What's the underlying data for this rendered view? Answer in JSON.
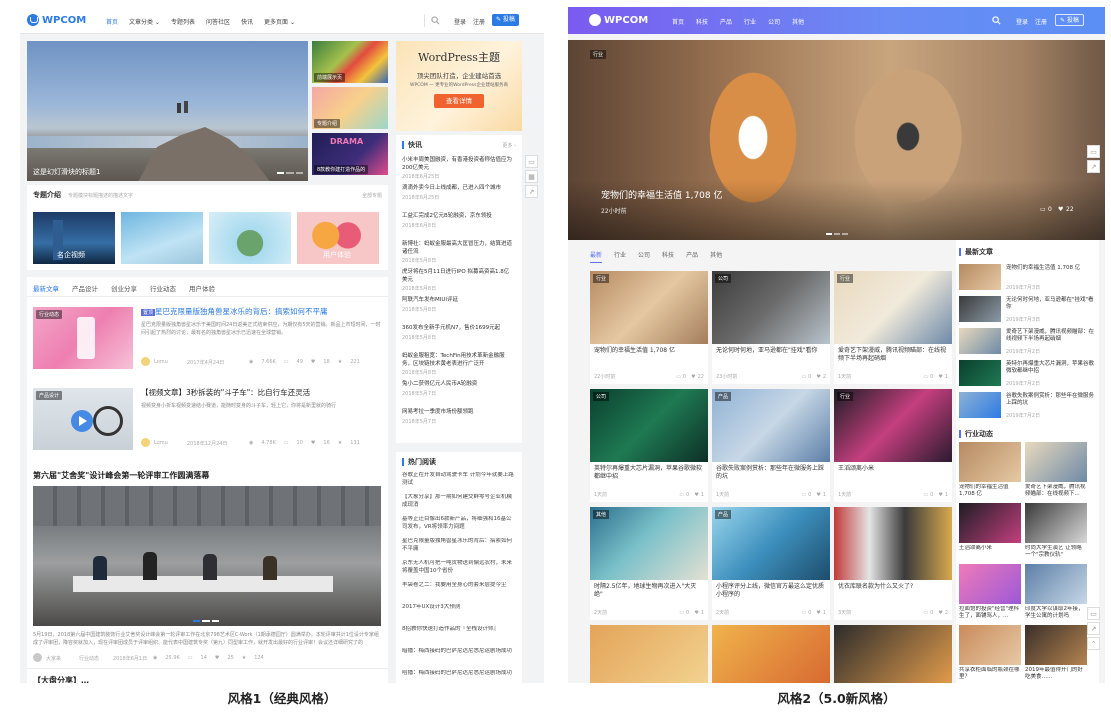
{
  "style1": {
    "nav": {
      "logo": "WPCOM",
      "links": [
        "首页",
        "文章分类 ⌄",
        "专题列表",
        "问答社区",
        "快讯",
        "更多页面 ⌄"
      ],
      "login": "登录",
      "register": "注册",
      "post": "✎ 投稿"
    },
    "hero": {
      "caption": "这是幻灯滑块的标题1"
    },
    "thumbs": [
      "前端展示页",
      "专题介绍",
      "8款教你建打造作品的"
    ],
    "ad": {
      "title": "WordPress主题",
      "sub": "顶尖团队打造，企业建站首选",
      "desc": "WPCOM — 更专业的WordPress企业建站服务商",
      "button": "查看详情"
    },
    "topics": {
      "title": "专题介绍",
      "sub": "专题模块标题描述的描述文字",
      "more": "全部专题",
      "items": [
        "名企视频",
        "",
        "",
        "用户体验"
      ]
    },
    "tabs": [
      "最新文章",
      "产品设计",
      "创业分享",
      "行业动态",
      "用户体验"
    ],
    "posts": [
      {
        "label": "行业动态",
        "badge": "置顶",
        "title": "星巴克限量版独角兽星冰乐的背后：搞索如何不平庸",
        "excerpt": "星巴克限量版独角兽星冰乐于美国时间24日返美正式结束供应，为期仅有5天的营销。新品上市短时间，一时间引起了热烈的讨论，最有名的独角兽星冰乐已迅速在全球营销。",
        "author": "Lomu",
        "date": "2017年4月24日",
        "views": "7.66K",
        "comments": "49",
        "likes": "18",
        "shares": "221"
      },
      {
        "label": "产品设计",
        "title": "【视频文章】3秒拆装的\"斗子车\"：比自行车还灵活",
        "excerpt": "视频变身小折车视频变速结小赛道，能随时变身的斗子车，轻上它，你将是新里就的骑行",
        "author": "Lomu",
        "date": "2018年12月24日",
        "views": "4.78K",
        "comments": "10",
        "likes": "16",
        "shares": "131"
      }
    ],
    "feature": {
      "title": "第六届\"艾舍奖\"设计峰会第一轮评审工作圆满落幕",
      "excerpt": "5月19日，2018第六届中国建筑装饰行业艾舍奖设计峰会第一轮评审工作在北京798艺术区C-Work（1期承德园厅）圆满举办。本轮评审共计1位设计专家组成了评审团，降容奖就加入，现在评审团成员于评审组织、能代表中国建筑专奖（第九）同型审工作，就开发出最好的行业评审！会议还详细研究了的",
      "author": "大家来",
      "cat": "行业动态",
      "date": "2018年6月1日",
      "views": "25.9K",
      "comments": "14",
      "likes": "25",
      "shares": "124"
    },
    "next_title": "【大盘分享】…",
    "flash": {
      "title": "快讯",
      "more": "更多 ›",
      "items": [
        {
          "t": "小米丰周美国融资，有香港投资者称估值应为200亿美元",
          "d": "2018年6月25日"
        },
        {
          "t": "滴滴外卖今日上线成都，已进入四个城市",
          "d": "2018年6月25日"
        },
        {
          "t": "工益汇完成2亿元B轮融资，京东领投",
          "d": "2018年6月8日"
        },
        {
          "t": "新博社：蚂蚁金服最高大匡冒压力，结算进道诸任流",
          "d": "2018年5月8日"
        },
        {
          "t": "虎牙将在5月11日进行IPO 拟募高资高1.8亿美元",
          "d": "2018年5月8日"
        },
        {
          "t": "阿联汽车发布MIUI评延",
          "d": "2018年5月8日"
        },
        {
          "t": "360发布全新手元机N7，售价1699元起",
          "d": "2018年5月8日"
        },
        {
          "t": "蚂蚁金服租宽：TechFin用技术革新金融服务，区块链技术黄老表进行广泛开",
          "d": "2018年5月8日"
        },
        {
          "t": "兔小二获得亿元人民币A轮融资",
          "d": "2018年5月7日"
        },
        {
          "t": "网易考拉一季度市场份额领跑",
          "d": "2018年5月7日"
        }
      ]
    },
    "hot": {
      "title": "热门阅读",
      "items": [
        "谷歌正在开发自动驾驶卡车 计划今年就要上路测试",
        "【大象分享】那一期如何建交群零号企业机械成现消",
        "基等正迁目像出6款新产品，将细强和16基公司发布，VR将领率力间题",
        "星巴克限量版独角兽星冰乐的背后：搞索如何不平庸",
        "京东无人机可把一吨货物送到偏远农村，未来将覆盖中国10个省份",
        "丰袋卷之二：我要用全身心的套来层提今尘",
        "2017年UX设计3大预测",
        "8招教你快速打造作品的『全栈设计师』",
        "暗播：梅西接码的巴萨尼达尼悉尼运剧场成功",
        "哈播：梅西接码的巴萨尼达尼悉尼运剧场成功"
      ]
    }
  },
  "style2": {
    "nav": {
      "logo": "WPCOM",
      "links": [
        "首页",
        "科技",
        "产品",
        "行业",
        "公司",
        "其他"
      ],
      "login": "登录",
      "register": "注册",
      "post": "✎ 投稿"
    },
    "hero": {
      "label": "行业",
      "title": "宠物们的幸福生活值 1,708 亿",
      "time": "22小时前",
      "comments": "0",
      "likes": "22"
    },
    "tabs": [
      "最新",
      "行业",
      "公司",
      "科技",
      "产品",
      "其他"
    ],
    "grid": [
      {
        "label": "行业",
        "title": "宠物们的幸福生活值 1,708 亿",
        "time": "22小时前",
        "c": "0",
        "l": "22"
      },
      {
        "label": "公司",
        "title": "无论何时何地，亚马逊都在\"挂戏\"看你",
        "time": "23小时前",
        "c": "0",
        "l": "2"
      },
      {
        "label": "行业",
        "title": "爱奇艺下架漫威，腾讯视频瞄部：在线视频下半场再起硝烟",
        "time": "1天前",
        "c": "0",
        "l": "1"
      },
      {
        "label": "公司",
        "title": "英特尔再爆重大芯片漏洞，苹果谷歌微软都继中招",
        "time": "1天前",
        "c": "0",
        "l": "1"
      },
      {
        "label": "产品",
        "title": "谷歌失败案例赏析：那些年在微服务上踩的坑",
        "time": "1天前",
        "c": "0",
        "l": "1"
      },
      {
        "label": "行业",
        "title": "王滔颂离小米",
        "time": "1天前",
        "c": "0",
        "l": "1"
      },
      {
        "label": "其他",
        "title": "时隔2.5亿年，地球生物再次进入\"大灭绝\"",
        "time": "2天前",
        "c": "0",
        "l": "1"
      },
      {
        "label": "产品",
        "title": "小程序评分上线，微信官方最这么定优质小程序的",
        "time": "2天前",
        "c": "0",
        "l": "1"
      },
      {
        "label": "",
        "title": "优衣库联名款为什么又火了?",
        "time": "3天前",
        "c": "0",
        "l": "2"
      }
    ],
    "latest": {
      "title": "最新文章",
      "items": [
        {
          "t": "宠物们的幸福生活值 1,708 亿",
          "d": "2019年7月3日"
        },
        {
          "t": "无论何时何地，亚马逊都在\"挂戏\"看你",
          "d": "2019年7月3日"
        },
        {
          "t": "爱奇艺下架漫威，腾讯视频瞄部：在线视频下半场再起硝烟",
          "d": "2019年7月2日"
        },
        {
          "t": "英特尔再爆重大芯片漏洞，苹果谷歌微软都继中招",
          "d": "2019年7月2日"
        },
        {
          "t": "谷歌失败案例赏析：那些年在微服务上踩的坑",
          "d": "2019年7月2日"
        }
      ]
    },
    "industry": {
      "title": "行业动态",
      "items": [
        "宠物们的幸福生活值 1,708 亿",
        "爱奇艺下架漫威，腾讯视频瞄部：在线视频下...",
        "王滔颂离小米",
        "时尚大学生演艺 让领略一个\"宗教仪轨\"",
        "拉面馆的投资\"经营\"理科生了，面铺骂人，…",
        "印度大学以谋取2年接，学生公寓的计划吗",
        "共享衣柜面临的瓶颈在哪里？",
        "2019年最值得开门的好吃美食……"
      ]
    }
  },
  "captions": [
    "风格1（经典风格）",
    "风格2（5.0新风格）"
  ]
}
